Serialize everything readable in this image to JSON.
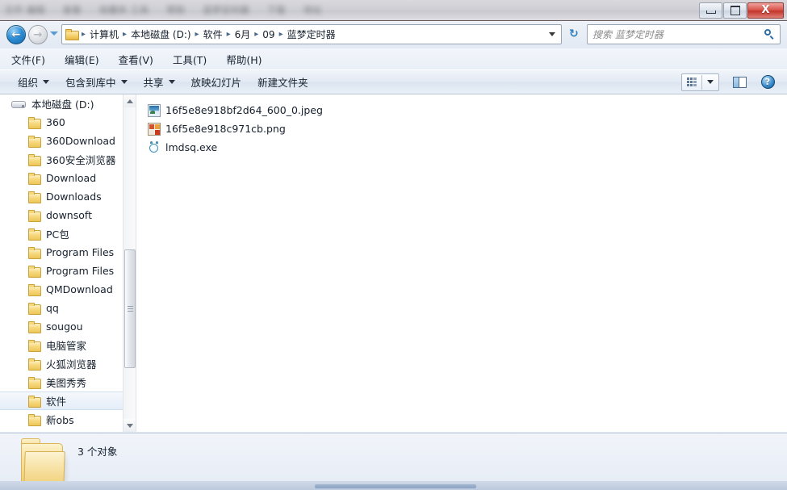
{
  "window": {
    "titlebar_obscured_text": [
      "文件 编辑",
      "查看",
      "收藏夹 工具",
      "帮助",
      "蓝梦定时器",
      "下载",
      "地址"
    ],
    "controls": {
      "minimize": "—",
      "maximize": "□",
      "close": "X"
    }
  },
  "address": {
    "back_arrow": "←",
    "forward_arrow": "→",
    "crumbs": [
      "计算机",
      "本地磁盘 (D:)",
      "软件",
      "6月",
      "09",
      "蓝梦定时器"
    ],
    "separator": "▸",
    "refresh_glyph": "↻"
  },
  "search": {
    "placeholder": "搜索 蓝梦定时器",
    "value": ""
  },
  "menu": {
    "items": [
      "文件(F)",
      "编辑(E)",
      "查看(V)",
      "工具(T)",
      "帮助(H)"
    ]
  },
  "toolbar": {
    "items": [
      {
        "label": "组织",
        "caret": true
      },
      {
        "label": "包含到库中",
        "caret": true
      },
      {
        "label": "共享",
        "caret": true
      },
      {
        "label": "放映幻灯片",
        "caret": false
      },
      {
        "label": "新建文件夹",
        "caret": false
      }
    ],
    "help_glyph": "?"
  },
  "navpane": {
    "items": [
      {
        "label": "本地磁盘 (D:)",
        "type": "drive",
        "selected": false
      },
      {
        "label": "360",
        "type": "folder",
        "selected": false
      },
      {
        "label": "360Download",
        "type": "folder",
        "selected": false
      },
      {
        "label": "360安全浏览器",
        "type": "folder",
        "selected": false
      },
      {
        "label": "Download",
        "type": "folder",
        "selected": false
      },
      {
        "label": "Downloads",
        "type": "folder",
        "selected": false
      },
      {
        "label": "downsoft",
        "type": "folder",
        "selected": false
      },
      {
        "label": "PC包",
        "type": "folder",
        "selected": false
      },
      {
        "label": "Program Files",
        "type": "folder",
        "selected": false
      },
      {
        "label": "Program Files",
        "type": "folder",
        "selected": false
      },
      {
        "label": "QMDownload",
        "type": "folder",
        "selected": false
      },
      {
        "label": "qq",
        "type": "folder",
        "selected": false
      },
      {
        "label": "sougou",
        "type": "folder",
        "selected": false
      },
      {
        "label": "电脑管家",
        "type": "folder",
        "selected": false
      },
      {
        "label": "火狐浏览器",
        "type": "folder",
        "selected": false
      },
      {
        "label": "美图秀秀",
        "type": "folder",
        "selected": false
      },
      {
        "label": "软件",
        "type": "folder",
        "selected": true
      },
      {
        "label": "新obs",
        "type": "folder",
        "selected": false
      }
    ]
  },
  "files": {
    "items": [
      {
        "name": "16f5e8e918bf2d64_600_0.jpeg",
        "icon": "jpeg-file-icon"
      },
      {
        "name": "16f5e8e918c971cb.png",
        "icon": "png-file-icon"
      },
      {
        "name": "lmdsq.exe",
        "icon": "alarm-clock-exe-icon"
      }
    ]
  },
  "status": {
    "count_text": "3 个对象"
  },
  "colors": {
    "accent_blue": "#2f8fd6",
    "folder_yellow": "#f5cf6a",
    "selection_blue": "#e4edf8",
    "close_red": "#c3352b"
  }
}
